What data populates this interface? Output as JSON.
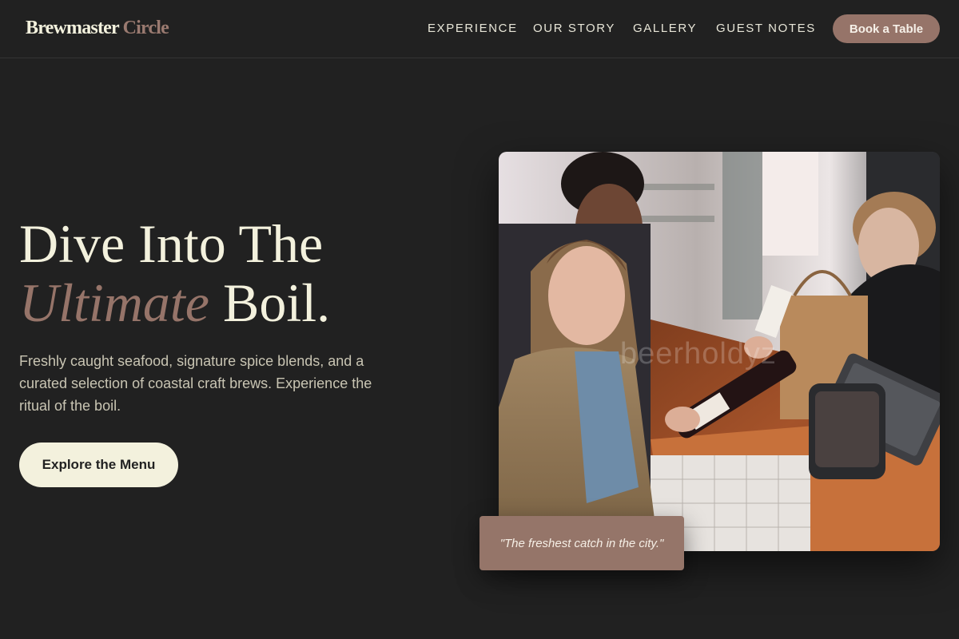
{
  "brand": {
    "name": "Brewmaster",
    "accent": "Circle"
  },
  "nav": {
    "items": [
      {
        "label": "EXPERIENCE"
      },
      {
        "label": "OUR STORY"
      },
      {
        "label": "GALLERY"
      },
      {
        "label": "GUEST NOTES"
      }
    ],
    "cta_label": "Book a Table"
  },
  "hero": {
    "line1": "Dive Into The",
    "line2_italic": "Ultimate",
    "line2_rest": "Boil.",
    "description": "Freshly caught seafood, signature spice blends, and a curated selection of coastal craft brews. Experience the ritual of the boil.",
    "button_label": "Explore the Menu",
    "photo_watermark": "beerholdyz",
    "quote": "\"The freshest catch in the city.\""
  },
  "colors": {
    "background": "#212121",
    "cream": "#f3f1dd",
    "accent": "#967469"
  }
}
